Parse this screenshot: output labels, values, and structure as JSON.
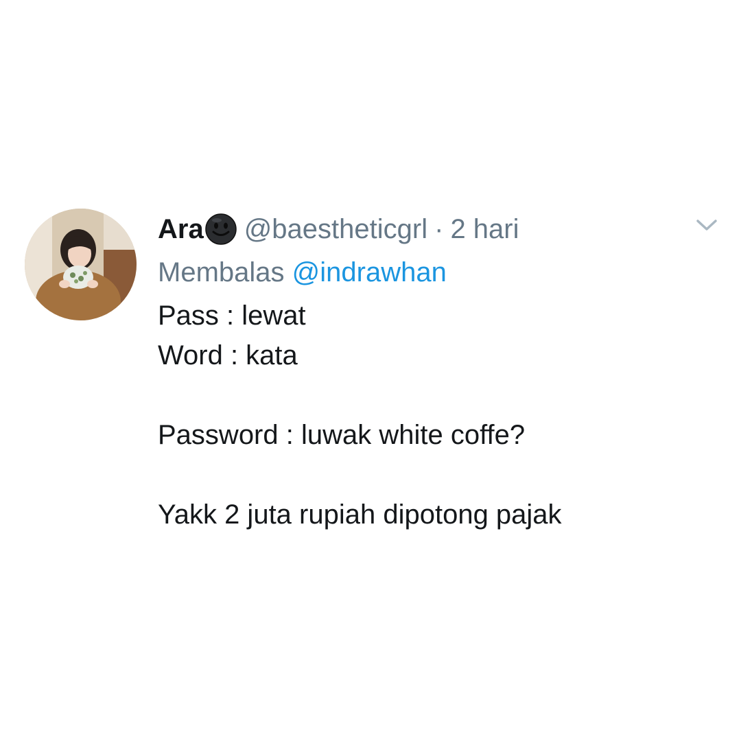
{
  "tweet": {
    "display_name": "Ara",
    "name_emoji": "smiling-face-dark-emoji",
    "handle": "@baestheticgrl",
    "separator": "·",
    "time": "2 hari",
    "reply_prefix": "Membalas",
    "reply_to": "@indrawhan",
    "lines": [
      "Pass : lewat",
      "Word : kata",
      "",
      "Password : luwak white coffe?",
      "",
      "Yakk 2 juta rupiah dipotong pajak"
    ],
    "menu_icon": "chevron-down-icon",
    "avatar_icon": "profile-photo"
  },
  "colors": {
    "text": "#14171a",
    "secondary": "#657786",
    "link": "#1b95e0",
    "chevron": "#aab8c2"
  }
}
